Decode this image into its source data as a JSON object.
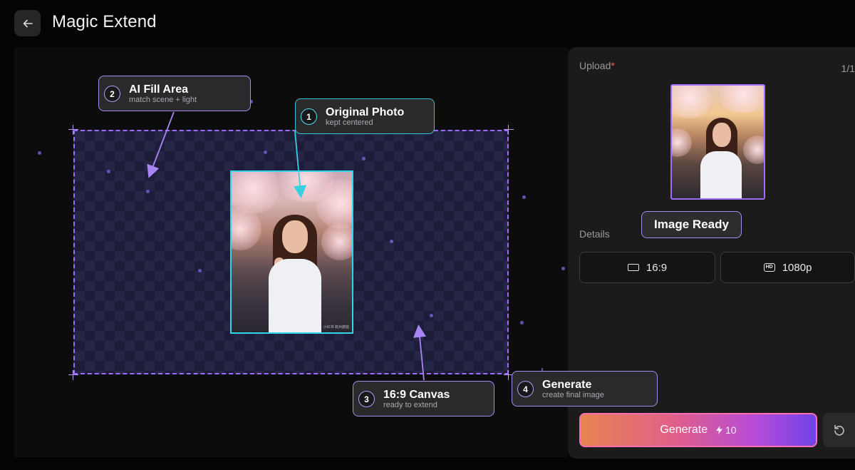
{
  "header": {
    "title": "Magic Extend",
    "back_icon": "arrow-left-icon"
  },
  "canvas": {
    "aspect": "16:9"
  },
  "photo": {
    "watermark": "小红书 杭州旅拍"
  },
  "callouts": [
    {
      "number": "1",
      "title": "Original Photo",
      "subtitle": "kept centered",
      "color": "#36c7d6"
    },
    {
      "number": "2",
      "title": "AI Fill Area",
      "subtitle": "match scene + light",
      "color": "#a98af0"
    },
    {
      "number": "3",
      "title": "16:9 Canvas",
      "subtitle": "ready to extend",
      "color": "#a98af0"
    },
    {
      "number": "4",
      "title": "Generate",
      "subtitle": "create final image",
      "color": "#a98af0"
    }
  ],
  "panel": {
    "upload_label": "Upload",
    "required_mark": "*",
    "upload_count": "1/1",
    "image_ready": "Image Ready",
    "details_label": "Details",
    "ratio_option": "16:9",
    "quality_option": "1080p",
    "quality_icon_text": "HD",
    "generate_label": "Generate",
    "credits": "10",
    "reset_icon": "refresh-icon"
  },
  "colors": {
    "accent_purple": "#9d6dff",
    "accent_cyan": "#2fd6ea",
    "accent_pink": "#ff6fb1"
  }
}
